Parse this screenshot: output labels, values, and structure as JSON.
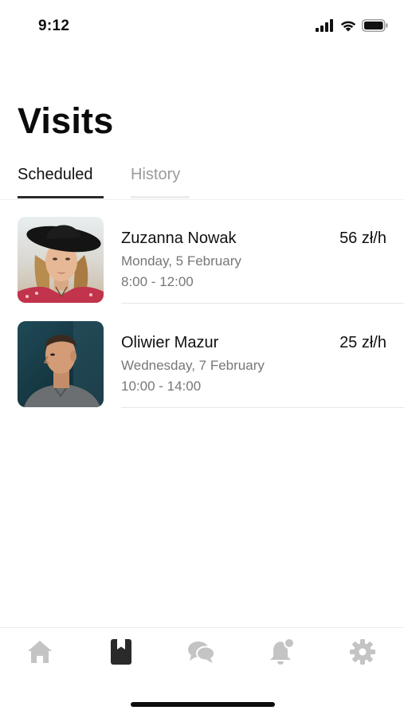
{
  "status_bar": {
    "time": "9:12"
  },
  "page": {
    "title": "Visits"
  },
  "tabs": [
    {
      "label": "Scheduled",
      "active": true
    },
    {
      "label": "History",
      "active": false
    }
  ],
  "visits": [
    {
      "name": "Zuzanna Nowak",
      "date": "Monday, 5 February",
      "time": "8:00 - 12:00",
      "rate": "56 zł/h",
      "avatar_icon": "woman-with-hat-photo"
    },
    {
      "name": "Oliwier Mazur",
      "date": "Wednesday, 7 February",
      "time": "10:00 - 14:00",
      "rate": "25 zł/h",
      "avatar_icon": "man-profile-photo"
    }
  ],
  "tab_bar": {
    "items": [
      {
        "icon": "home-icon",
        "active": false
      },
      {
        "icon": "book-icon",
        "active": true
      },
      {
        "icon": "chat-icon",
        "active": false
      },
      {
        "icon": "bell-icon",
        "active": false
      },
      {
        "icon": "gear-icon",
        "active": false
      }
    ]
  },
  "colors": {
    "text_primary": "#111111",
    "text_secondary": "#777777",
    "tab_inactive": "#9b9b9b",
    "icon_inactive": "#c4c4c4",
    "icon_active": "#2a2a2a",
    "divider": "#e6e6e6"
  }
}
